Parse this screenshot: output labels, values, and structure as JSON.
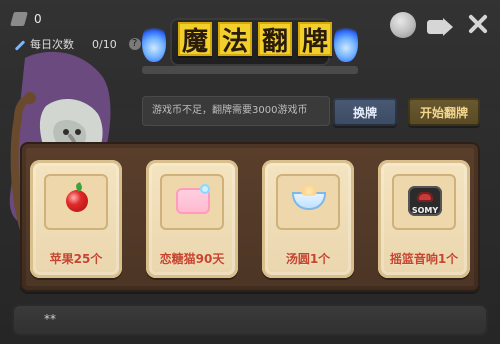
{
  "title": {
    "tiles": [
      "魔",
      "法",
      "翻",
      "牌"
    ]
  },
  "resources": {
    "coins": "0",
    "daily_label": "每日次数",
    "daily_value": "0/10",
    "help": "?"
  },
  "speech": {
    "text": "游戏币不足，翻牌需要3000游戏币"
  },
  "buttons": {
    "swap": "换牌",
    "start": "开始翻牌"
  },
  "cards": [
    {
      "label": "苹果25个",
      "icon": "apple-icon"
    },
    {
      "label": "恋糖猫90天",
      "icon": "blanket-icon"
    },
    {
      "label": "汤圆1个",
      "icon": "bowl-icon"
    },
    {
      "label": "摇篮音响1个",
      "icon": "speaker-icon",
      "icon_text": "SOMY"
    }
  ],
  "bottom": {
    "text": "**"
  },
  "colors": {
    "title_tile": "#f3cf2b",
    "card_label": "#c6452f",
    "swap_button": "#44546d",
    "start_button": "#635329"
  }
}
